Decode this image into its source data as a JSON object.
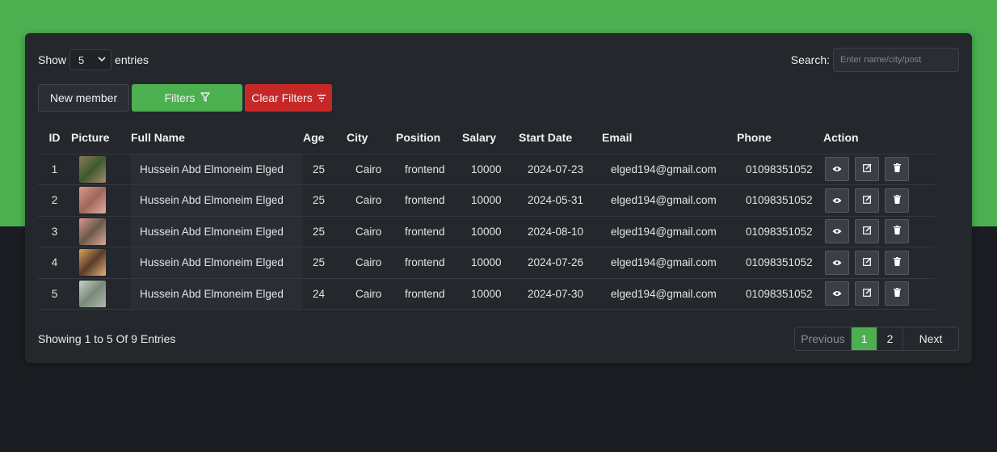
{
  "controls": {
    "show_label": "Show",
    "entries_value": "5",
    "entries_label": "entries",
    "search_label": "Search:",
    "search_placeholder": "Enter name/city/post"
  },
  "buttons": {
    "new_member": "New member",
    "filters": "Filters",
    "clear_filters": "Clear Filters"
  },
  "colors": {
    "accent_green": "#4caf50",
    "danger_red": "#c62828",
    "card_bg": "#24272c",
    "page_bg": "#1b1d22"
  },
  "table": {
    "headers": [
      "ID",
      "Picture",
      "Full Name",
      "Age",
      "City",
      "Position",
      "Salary",
      "Start Date",
      "Email",
      "Phone",
      "Action"
    ],
    "rows": [
      {
        "id": "1",
        "name": "Hussein Abd Elmoneim Elged",
        "age": "25",
        "city": "Cairo",
        "position": "frontend",
        "salary": "10000",
        "start": "2024-07-23",
        "email": "elged194@gmail.com",
        "phone": "01098351052"
      },
      {
        "id": "2",
        "name": "Hussein Abd Elmoneim Elged",
        "age": "25",
        "city": "Cairo",
        "position": "frontend",
        "salary": "10000",
        "start": "2024-05-31",
        "email": "elged194@gmail.com",
        "phone": "01098351052"
      },
      {
        "id": "3",
        "name": "Hussein Abd Elmoneim Elged",
        "age": "25",
        "city": "Cairo",
        "position": "frontend",
        "salary": "10000",
        "start": "2024-08-10",
        "email": "elged194@gmail.com",
        "phone": "01098351052"
      },
      {
        "id": "4",
        "name": "Hussein Abd Elmoneim Elged",
        "age": "25",
        "city": "Cairo",
        "position": "frontend",
        "salary": "10000",
        "start": "2024-07-26",
        "email": "elged194@gmail.com",
        "phone": "01098351052"
      },
      {
        "id": "5",
        "name": "Hussein Abd Elmoneim Elged",
        "age": "24",
        "city": "Cairo",
        "position": "frontend",
        "salary": "10000",
        "start": "2024-07-30",
        "email": "elged194@gmail.com",
        "phone": "01098351052"
      }
    ],
    "action_icons": [
      "eye-icon",
      "edit-icon",
      "trash-icon"
    ]
  },
  "footer": {
    "showing_text": "Showing 1 to 5 Of 9 Entries",
    "prev_label": "Previous",
    "page_1": "1",
    "page_2": "2",
    "next_label": "Next",
    "current_page": 1
  }
}
